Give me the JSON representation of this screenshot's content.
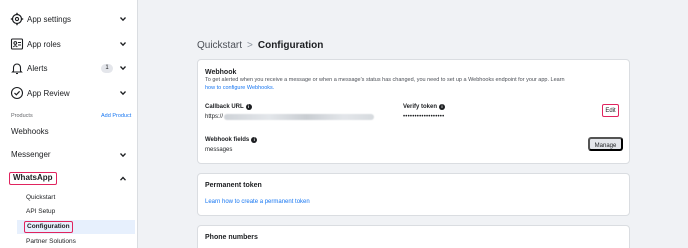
{
  "sidebar": {
    "top_items": [
      {
        "label": "App settings",
        "icon": "gear-icon"
      },
      {
        "label": "App roles",
        "icon": "roles-icon"
      },
      {
        "label": "Alerts",
        "icon": "bell-icon",
        "badge": "1"
      },
      {
        "label": "App Review",
        "icon": "shield-check-icon"
      }
    ],
    "products_label": "Products",
    "add_product_label": "Add Product",
    "webhooks_label": "Webhooks",
    "messenger_label": "Messenger",
    "whatsapp_label": "WhatsApp",
    "whatsapp_sub": [
      "Quickstart",
      "API Setup",
      "Configuration",
      "Partner Solutions"
    ]
  },
  "breadcrumb": {
    "parent": "Quickstart",
    "separator": ">",
    "current": "Configuration"
  },
  "webhook": {
    "title": "Webhook",
    "description": "To get alerted when you receive a message or when a message's status has changed, you need to set up a Webhooks endpoint for your app. Learn",
    "link": "how to configure Webhooks.",
    "callback_label": "Callback URL",
    "callback_value": "https://",
    "verify_label": "Verify token",
    "verify_value": "••••••••••••••••••",
    "edit_label": "Edit",
    "fields_label": "Webhook fields",
    "fields_value": "messages",
    "manage_label": "Manage"
  },
  "permanent_token": {
    "title": "Permanent token",
    "link": "Learn how to create a permanent token"
  },
  "phone_numbers": {
    "title": "Phone numbers"
  },
  "colors": {
    "accent": "#1877f2",
    "highlight_box": "#e0245e",
    "active_bg": "#e7f0fd",
    "page_bg": "#f0f2f5"
  }
}
